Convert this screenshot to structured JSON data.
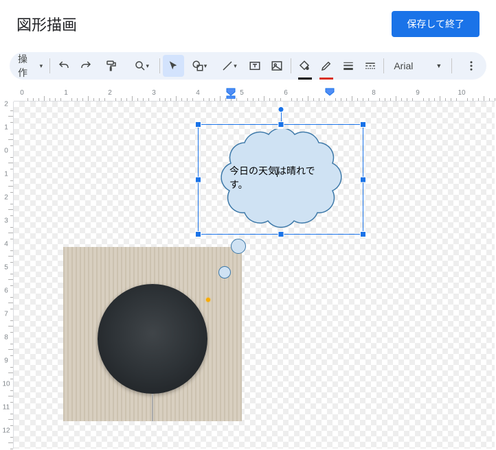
{
  "header": {
    "title": "図形描画",
    "save_label": "保存して終了"
  },
  "toolbar": {
    "actions_label": "操作",
    "font_name": "Arial",
    "fill_underline": "#000",
    "line_underline": "#d93025"
  },
  "ruler": {
    "h_labels": [
      "0",
      "1",
      "2",
      "3",
      "4",
      "5",
      "6",
      "7",
      "8",
      "9",
      "10"
    ],
    "v_labels": [
      "2",
      "1",
      "0",
      "1",
      "2",
      "3",
      "4",
      "5",
      "6",
      "7",
      "8",
      "9",
      "10",
      "11",
      "12"
    ]
  },
  "cloud": {
    "text_before_cursor": "今日の天気",
    "text_after_cursor": "は晴れです。"
  }
}
